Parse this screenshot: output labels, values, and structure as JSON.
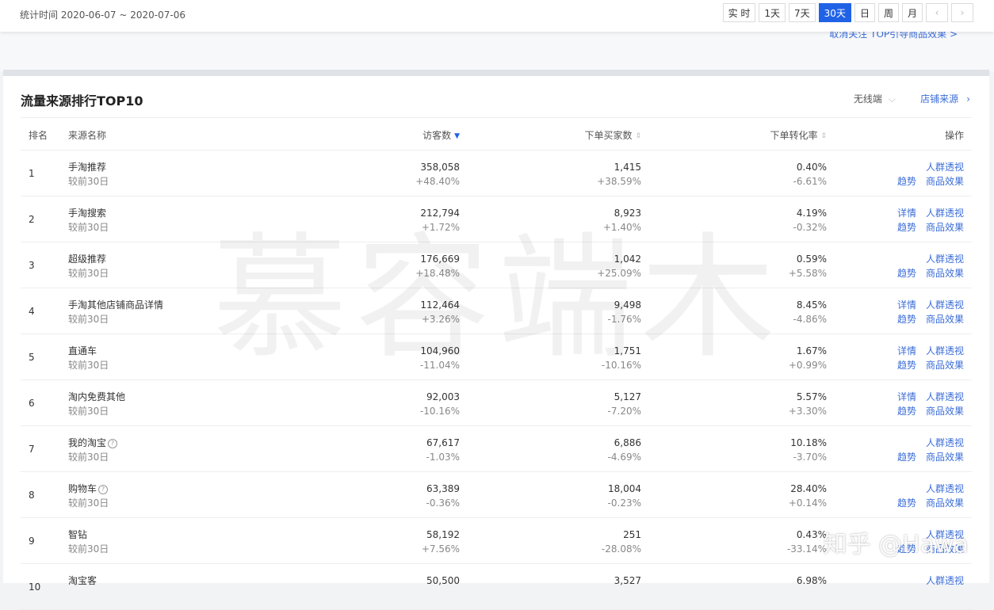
{
  "header": {
    "stat_time": "统计时间 2020-06-07 ~ 2020-07-06",
    "ranges": [
      "实 时",
      "1天",
      "7天",
      "30天",
      "日",
      "周",
      "月"
    ],
    "active_range": "30天"
  },
  "peek_link": "取消关注 TOP引导商品效果 >",
  "card": {
    "title": "流量来源排行TOP10",
    "device": "无线端",
    "shop_source": "店铺来源"
  },
  "table": {
    "headers": {
      "rank": "排名",
      "name": "来源名称",
      "visitors": "访客数",
      "buyers": "下单买家数",
      "rate": "下单转化率",
      "op": "操作"
    },
    "compare_label": "较前30日",
    "rows": [
      {
        "rank": "1",
        "name": "手淘推荐",
        "help": false,
        "visitors": "358,058",
        "visitors_delta": "+48.40%",
        "buyers": "1,415",
        "buyers_delta": "+38.59%",
        "rate": "0.40%",
        "rate_delta": "-6.61%",
        "op_top": [
          "人群透视"
        ],
        "op_bot": [
          "趋势",
          "商品效果"
        ]
      },
      {
        "rank": "2",
        "name": "手淘搜索",
        "help": false,
        "visitors": "212,794",
        "visitors_delta": "+1.72%",
        "buyers": "8,923",
        "buyers_delta": "+1.40%",
        "rate": "4.19%",
        "rate_delta": "-0.32%",
        "op_top": [
          "详情",
          "人群透视"
        ],
        "op_bot": [
          "趋势",
          "商品效果"
        ]
      },
      {
        "rank": "3",
        "name": "超级推荐",
        "help": false,
        "visitors": "176,669",
        "visitors_delta": "+18.48%",
        "buyers": "1,042",
        "buyers_delta": "+25.09%",
        "rate": "0.59%",
        "rate_delta": "+5.58%",
        "op_top": [
          "人群透视"
        ],
        "op_bot": [
          "趋势",
          "商品效果"
        ]
      },
      {
        "rank": "4",
        "name": "手淘其他店铺商品详情",
        "help": false,
        "visitors": "112,464",
        "visitors_delta": "+3.26%",
        "buyers": "9,498",
        "buyers_delta": "-1.76%",
        "rate": "8.45%",
        "rate_delta": "-4.86%",
        "op_top": [
          "详情",
          "人群透视"
        ],
        "op_bot": [
          "趋势",
          "商品效果"
        ]
      },
      {
        "rank": "5",
        "name": "直通车",
        "help": false,
        "visitors": "104,960",
        "visitors_delta": "-11.04%",
        "buyers": "1,751",
        "buyers_delta": "-10.16%",
        "rate": "1.67%",
        "rate_delta": "+0.99%",
        "op_top": [
          "详情",
          "人群透视"
        ],
        "op_bot": [
          "趋势",
          "商品效果"
        ]
      },
      {
        "rank": "6",
        "name": "淘内免费其他",
        "help": false,
        "visitors": "92,003",
        "visitors_delta": "-10.16%",
        "buyers": "5,127",
        "buyers_delta": "-7.20%",
        "rate": "5.57%",
        "rate_delta": "+3.30%",
        "op_top": [
          "详情",
          "人群透视"
        ],
        "op_bot": [
          "趋势",
          "商品效果"
        ]
      },
      {
        "rank": "7",
        "name": "我的淘宝",
        "help": true,
        "visitors": "67,617",
        "visitors_delta": "-1.03%",
        "buyers": "6,886",
        "buyers_delta": "-4.69%",
        "rate": "10.18%",
        "rate_delta": "-3.70%",
        "op_top": [
          "人群透视"
        ],
        "op_bot": [
          "趋势",
          "商品效果"
        ]
      },
      {
        "rank": "8",
        "name": "购物车",
        "help": true,
        "visitors": "63,389",
        "visitors_delta": "-0.36%",
        "buyers": "18,004",
        "buyers_delta": "-0.23%",
        "rate": "28.40%",
        "rate_delta": "+0.14%",
        "op_top": [
          "人群透视"
        ],
        "op_bot": [
          "趋势",
          "商品效果"
        ]
      },
      {
        "rank": "9",
        "name": "智钻",
        "help": false,
        "visitors": "58,192",
        "visitors_delta": "+7.56%",
        "buyers": "251",
        "buyers_delta": "-28.08%",
        "rate": "0.43%",
        "rate_delta": "-33.14%",
        "op_top": [
          "人群透视"
        ],
        "op_bot": [
          "趋势",
          "商品效果"
        ]
      },
      {
        "rank": "10",
        "name": "淘宝客",
        "help": false,
        "visitors": "50,500",
        "visitors_delta": "",
        "buyers": "3,527",
        "buyers_delta": "",
        "rate": "6.98%",
        "rate_delta": "",
        "op_top": [
          "人群透视"
        ],
        "op_bot": []
      }
    ]
  },
  "watermark": "慕容端木",
  "zhihu": "知乎 @Hawa",
  "colors": {
    "accent": "#2062e6",
    "link": "#3b6dd8",
    "up": "#e4393c",
    "down_green": "#2f9a3a"
  }
}
